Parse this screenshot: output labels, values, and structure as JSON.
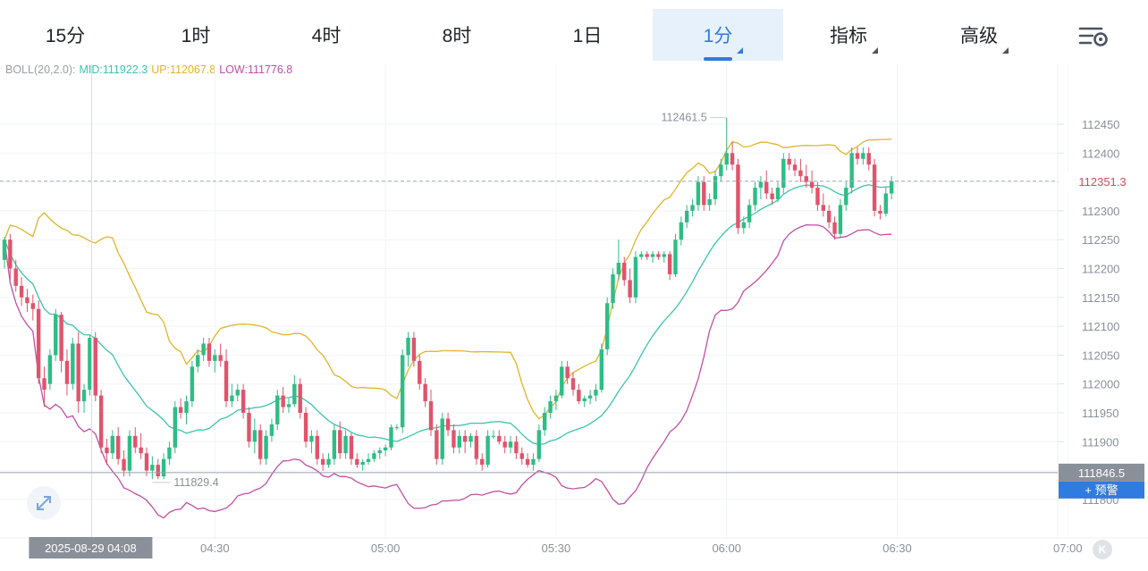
{
  "tabs": [
    {
      "label": "15分",
      "dropdown": false
    },
    {
      "label": "1时",
      "dropdown": false
    },
    {
      "label": "4时",
      "dropdown": false
    },
    {
      "label": "8时",
      "dropdown": false
    },
    {
      "label": "1日",
      "dropdown": false
    },
    {
      "label": "1分",
      "dropdown": true,
      "active": true
    },
    {
      "label": "指标",
      "dropdown": true
    },
    {
      "label": "高级",
      "dropdown": true
    }
  ],
  "icons": {
    "settings": "chart-settings-icon",
    "expand": "expand-arrows-icon",
    "k": "k-logo-icon"
  },
  "indicator": {
    "name": "BOLL(20,2.0):",
    "mid": "MID:111922.3",
    "up": "UP:112067.8",
    "low": "LOW:111776.8"
  },
  "colors": {
    "up_candle": "#2ebd85",
    "down_candle": "#e0546b",
    "mid_line": "#3cc4ae",
    "up_line": "#e0b52a",
    "low_line": "#c24fa5",
    "accent": "#2f7be0",
    "current_price": "#d9485f"
  },
  "price_axis": {
    "ticks": [
      "112450",
      "112400",
      "112350",
      "112300",
      "112250",
      "112200",
      "112150",
      "112100",
      "112050",
      "112000",
      "111950",
      "111900",
      "111850",
      "111800"
    ]
  },
  "time_axis": {
    "ticks": [
      "04:30",
      "05:00",
      "05:30",
      "06:00",
      "06:30",
      "07:00"
    ],
    "crosshair_label": "2025-08-29 04:08"
  },
  "markers": {
    "high_label": "112461.5",
    "low_label": "111829.4",
    "current_price": "112351.3",
    "crosshair_price": "111846.5",
    "alert_label": "+ 预警"
  },
  "chart_data": {
    "type": "candlestick",
    "ylim": [
      111775,
      112520
    ],
    "high": 112461.5,
    "low": 111829.4,
    "current_price": 112351.3,
    "crosshair_price": 111846.5,
    "start_time": "03:53",
    "interval_minutes": 1,
    "candles": [
      [
        112215,
        112255,
        112200,
        112250
      ],
      [
        112250,
        112260,
        112180,
        112200
      ],
      [
        112200,
        112215,
        112160,
        112170
      ],
      [
        112170,
        112185,
        112135,
        112150
      ],
      [
        112150,
        112165,
        112125,
        112140
      ],
      [
        112140,
        112155,
        112110,
        112130
      ],
      [
        112130,
        112145,
        112000,
        112010
      ],
      [
        112010,
        112030,
        111960,
        111990
      ],
      [
        112000,
        112060,
        111990,
        112050
      ],
      [
        112050,
        112130,
        112040,
        112120
      ],
      [
        112120,
        112125,
        112020,
        112040
      ],
      [
        112040,
        112060,
        111980,
        112000
      ],
      [
        112000,
        112080,
        111990,
        112070
      ],
      [
        112070,
        112090,
        111950,
        111970
      ],
      [
        111970,
        112000,
        111950,
        111990
      ],
      [
        111990,
        112085,
        111980,
        112080
      ],
      [
        112080,
        112090,
        111970,
        111980
      ],
      [
        111980,
        111990,
        111880,
        111890
      ],
      [
        111890,
        111905,
        111860,
        111880
      ],
      [
        111880,
        111920,
        111870,
        111910
      ],
      [
        111910,
        111925,
        111860,
        111870
      ],
      [
        111870,
        111885,
        111840,
        111850
      ],
      [
        111850,
        111920,
        111840,
        111910
      ],
      [
        111910,
        111925,
        111880,
        111890
      ],
      [
        111890,
        111915,
        111870,
        111880
      ],
      [
        111880,
        111890,
        111840,
        111850
      ],
      [
        111850,
        111875,
        111835,
        111860
      ],
      [
        111860,
        111870,
        111835,
        111840
      ],
      [
        111840,
        111880,
        111835,
        111870
      ],
      [
        111870,
        111900,
        111860,
        111890
      ],
      [
        111890,
        111970,
        111880,
        111960
      ],
      [
        111960,
        111975,
        111940,
        111950
      ],
      [
        111950,
        111980,
        111930,
        111970
      ],
      [
        111970,
        112040,
        111960,
        112030
      ],
      [
        112030,
        112060,
        112020,
        112050
      ],
      [
        112050,
        112080,
        112040,
        112070
      ],
      [
        112070,
        112080,
        112030,
        112040
      ],
      [
        112040,
        112060,
        112020,
        112050
      ],
      [
        112050,
        112070,
        112030,
        112040
      ],
      [
        112040,
        112060,
        111960,
        111970
      ],
      [
        111970,
        112000,
        111960,
        111980
      ],
      [
        111980,
        112000,
        111970,
        111990
      ],
      [
        111990,
        112000,
        111940,
        111950
      ],
      [
        111950,
        111960,
        111890,
        111900
      ],
      [
        111900,
        111940,
        111880,
        111920
      ],
      [
        111920,
        111930,
        111860,
        111870
      ],
      [
        111870,
        111920,
        111860,
        111910
      ],
      [
        111910,
        111940,
        111900,
        111930
      ],
      [
        111930,
        111990,
        111920,
        111980
      ],
      [
        111980,
        111995,
        111950,
        111960
      ],
      [
        111960,
        111975,
        111950,
        111965
      ],
      [
        111965,
        112015,
        111960,
        112000
      ],
      [
        112000,
        112010,
        111940,
        111950
      ],
      [
        111950,
        111960,
        111890,
        111900
      ],
      [
        111900,
        111920,
        111880,
        111910
      ],
      [
        111910,
        111920,
        111860,
        111870
      ],
      [
        111870,
        111880,
        111850,
        111860
      ],
      [
        111860,
        111880,
        111855,
        111870
      ],
      [
        111870,
        111930,
        111860,
        111920
      ],
      [
        111920,
        111935,
        111870,
        111880
      ],
      [
        111880,
        111920,
        111870,
        111910
      ],
      [
        111910,
        111915,
        111860,
        111870
      ],
      [
        111870,
        111880,
        111855,
        111860
      ],
      [
        111860,
        111870,
        111850,
        111865
      ],
      [
        111865,
        111880,
        111860,
        111870
      ],
      [
        111870,
        111885,
        111865,
        111880
      ],
      [
        111880,
        111890,
        111870,
        111885
      ],
      [
        111885,
        111895,
        111875,
        111890
      ],
      [
        111890,
        111930,
        111885,
        111925
      ],
      [
        111925,
        111930,
        111920,
        111925
      ],
      [
        111925,
        112060,
        111915,
        112050
      ],
      [
        112050,
        112090,
        112030,
        112080
      ],
      [
        112080,
        112090,
        112030,
        112040
      ],
      [
        112040,
        112050,
        111990,
        112000
      ],
      [
        112000,
        112010,
        111960,
        111970
      ],
      [
        111970,
        111990,
        111910,
        111920
      ],
      [
        111920,
        111930,
        111860,
        111870
      ],
      [
        111870,
        111950,
        111860,
        111940
      ],
      [
        111940,
        111950,
        111910,
        111920
      ],
      [
        111920,
        111930,
        111880,
        111890
      ],
      [
        111890,
        111920,
        111880,
        111910
      ],
      [
        111910,
        111920,
        111880,
        111900
      ],
      [
        111900,
        111915,
        111890,
        111910
      ],
      [
        111910,
        111920,
        111860,
        111870
      ],
      [
        111870,
        111880,
        111850,
        111860
      ],
      [
        111860,
        111920,
        111855,
        111910
      ],
      [
        111910,
        111920,
        111905,
        111910
      ],
      [
        111910,
        111920,
        111895,
        111900
      ],
      [
        111900,
        111910,
        111880,
        111890
      ],
      [
        111890,
        111910,
        111880,
        111900
      ],
      [
        111900,
        111910,
        111870,
        111880
      ],
      [
        111880,
        111890,
        111860,
        111870
      ],
      [
        111870,
        111880,
        111855,
        111860
      ],
      [
        111860,
        111880,
        111850,
        111870
      ],
      [
        111870,
        111930,
        111865,
        111920
      ],
      [
        111920,
        111960,
        111910,
        111950
      ],
      [
        111950,
        111980,
        111940,
        111970
      ],
      [
        111970,
        111990,
        111955,
        111980
      ],
      [
        111980,
        112040,
        111975,
        112030
      ],
      [
        112030,
        112040,
        112000,
        112010
      ],
      [
        112010,
        112020,
        111980,
        111990
      ],
      [
        111990,
        112000,
        111965,
        111970
      ],
      [
        111970,
        111980,
        111960,
        111975
      ],
      [
        111975,
        111990,
        111965,
        111980
      ],
      [
        111980,
        112000,
        111970,
        111990
      ],
      [
        111990,
        112070,
        111985,
        112060
      ],
      [
        112060,
        112150,
        112050,
        112140
      ],
      [
        112140,
        112200,
        112130,
        112190
      ],
      [
        112190,
        112250,
        112180,
        112210
      ],
      [
        112210,
        112220,
        112170,
        112180
      ],
      [
        112180,
        112200,
        112140,
        112150
      ],
      [
        112150,
        112230,
        112140,
        112220
      ],
      [
        112220,
        112230,
        112215,
        112225
      ],
      [
        112225,
        112230,
        112215,
        112220
      ],
      [
        112220,
        112230,
        112210,
        112225
      ],
      [
        112225,
        112230,
        112215,
        112220
      ],
      [
        112220,
        112230,
        112210,
        112225
      ],
      [
        112225,
        112230,
        112180,
        112190
      ],
      [
        112190,
        112260,
        112185,
        112250
      ],
      [
        112250,
        112290,
        112240,
        112280
      ],
      [
        112280,
        112310,
        112270,
        112300
      ],
      [
        112300,
        112320,
        112290,
        112310
      ],
      [
        112310,
        112360,
        112300,
        112350
      ],
      [
        112350,
        112360,
        112300,
        112310
      ],
      [
        112310,
        112330,
        112300,
        112320
      ],
      [
        112320,
        112370,
        112310,
        112360
      ],
      [
        112360,
        112390,
        112350,
        112380
      ],
      [
        112380,
        112461,
        112370,
        112400
      ],
      [
        112400,
        112420,
        112370,
        112380
      ],
      [
        112380,
        112390,
        112260,
        112270
      ],
      [
        112270,
        112290,
        112260,
        112280
      ],
      [
        112280,
        112320,
        112270,
        112310
      ],
      [
        112310,
        112350,
        112300,
        112340
      ],
      [
        112340,
        112360,
        112320,
        112350
      ],
      [
        112350,
        112370,
        112320,
        112330
      ],
      [
        112330,
        112340,
        112310,
        112320
      ],
      [
        112320,
        112350,
        112315,
        112340
      ],
      [
        112340,
        112400,
        112330,
        112390
      ],
      [
        112390,
        112400,
        112370,
        112380
      ],
      [
        112380,
        112390,
        112360,
        112370
      ],
      [
        112370,
        112390,
        112350,
        112360
      ],
      [
        112360,
        112380,
        112340,
        112350
      ],
      [
        112350,
        112370,
        112330,
        112340
      ],
      [
        112340,
        112350,
        112300,
        112310
      ],
      [
        112310,
        112330,
        112290,
        112300
      ],
      [
        112300,
        112310,
        112270,
        112280
      ],
      [
        112280,
        112290,
        112250,
        112260
      ],
      [
        112260,
        112320,
        112255,
        112310
      ],
      [
        112310,
        112350,
        112300,
        112340
      ],
      [
        112340,
        112410,
        112330,
        112400
      ],
      [
        112400,
        112410,
        112380,
        112390
      ],
      [
        112390,
        112410,
        112380,
        112400
      ],
      [
        112400,
        112410,
        112370,
        112380
      ],
      [
        112380,
        112390,
        112290,
        112300
      ],
      [
        112300,
        112310,
        112285,
        112295
      ],
      [
        112295,
        112340,
        112290,
        112330
      ],
      [
        112330,
        112360,
        112320,
        112351
      ]
    ]
  }
}
